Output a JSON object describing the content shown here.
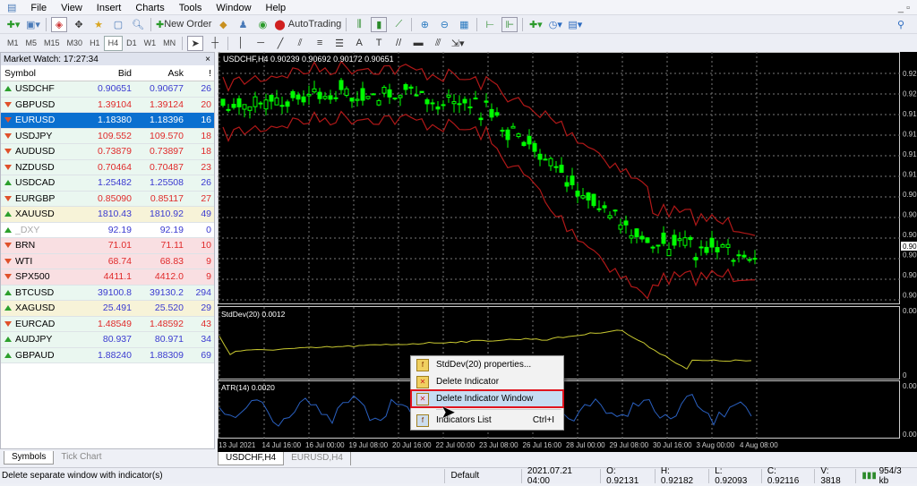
{
  "menu": {
    "items": [
      "File",
      "View",
      "Insert",
      "Charts",
      "Tools",
      "Window",
      "Help"
    ]
  },
  "toolbar": {
    "new_order": "New Order",
    "autotrading": "AutoTrading",
    "timeframes": [
      "M1",
      "M5",
      "M15",
      "M30",
      "H1",
      "H4",
      "D1",
      "W1",
      "MN"
    ],
    "active_timeframe": "H4"
  },
  "market_watch": {
    "title": "Market Watch: 17:27:34",
    "columns": [
      "Symbol",
      "Bid",
      "Ask",
      "!"
    ],
    "rows": [
      {
        "symbol": "USDCHF",
        "bid": "0.90651",
        "ask": "0.90677",
        "spread": "26",
        "dir": "up",
        "bg": "#eaf7f0",
        "color": "#3a3ad0"
      },
      {
        "symbol": "GBPUSD",
        "bid": "1.39104",
        "ask": "1.39124",
        "spread": "20",
        "dir": "down",
        "bg": "#eaf7f0",
        "color": "#e02a2a"
      },
      {
        "symbol": "EURUSD",
        "bid": "1.18380",
        "ask": "1.18396",
        "spread": "16",
        "dir": "down",
        "bg": "#0a6fd0",
        "color": "#ffffff",
        "selected": true
      },
      {
        "symbol": "USDJPY",
        "bid": "109.552",
        "ask": "109.570",
        "spread": "18",
        "dir": "down",
        "bg": "#eaf7f0",
        "color": "#e02a2a"
      },
      {
        "symbol": "AUDUSD",
        "bid": "0.73879",
        "ask": "0.73897",
        "spread": "18",
        "dir": "down",
        "bg": "#eaf7f0",
        "color": "#e02a2a"
      },
      {
        "symbol": "NZDUSD",
        "bid": "0.70464",
        "ask": "0.70487",
        "spread": "23",
        "dir": "down",
        "bg": "#eaf7f0",
        "color": "#e02a2a"
      },
      {
        "symbol": "USDCAD",
        "bid": "1.25482",
        "ask": "1.25508",
        "spread": "26",
        "dir": "up",
        "bg": "#eaf7f0",
        "color": "#3a3ad0"
      },
      {
        "symbol": "EURGBP",
        "bid": "0.85090",
        "ask": "0.85117",
        "spread": "27",
        "dir": "down",
        "bg": "#eaf7f0",
        "color": "#e02a2a"
      },
      {
        "symbol": "XAUUSD",
        "bid": "1810.43",
        "ask": "1810.92",
        "spread": "49",
        "dir": "up",
        "bg": "#f7f3d8",
        "color": "#3a3ad0"
      },
      {
        "symbol": "_DXY",
        "bid": "92.19",
        "ask": "92.19",
        "spread": "0",
        "dir": "up",
        "bg": "#ffffff",
        "color": "#3a3ad0",
        "muted": true
      },
      {
        "symbol": "BRN",
        "bid": "71.01",
        "ask": "71.11",
        "spread": "10",
        "dir": "down",
        "bg": "#f9dfe2",
        "color": "#e02a2a"
      },
      {
        "symbol": "WTI",
        "bid": "68.74",
        "ask": "68.83",
        "spread": "9",
        "dir": "down",
        "bg": "#f9dfe2",
        "color": "#e02a2a"
      },
      {
        "symbol": "SPX500",
        "bid": "4411.1",
        "ask": "4412.0",
        "spread": "9",
        "dir": "down",
        "bg": "#f9dfe2",
        "color": "#e02a2a"
      },
      {
        "symbol": "BTCUSD",
        "bid": "39100.8",
        "ask": "39130.2",
        "spread": "294",
        "dir": "up",
        "bg": "#eaf7f0",
        "color": "#3a3ad0"
      },
      {
        "symbol": "XAGUSD",
        "bid": "25.491",
        "ask": "25.520",
        "spread": "29",
        "dir": "up",
        "bg": "#f7f3d8",
        "color": "#3a3ad0"
      },
      {
        "symbol": "EURCAD",
        "bid": "1.48549",
        "ask": "1.48592",
        "spread": "43",
        "dir": "down",
        "bg": "#eaf7f0",
        "color": "#e02a2a"
      },
      {
        "symbol": "AUDJPY",
        "bid": "80.937",
        "ask": "80.971",
        "spread": "34",
        "dir": "up",
        "bg": "#eaf7f0",
        "color": "#3a3ad0"
      },
      {
        "symbol": "GBPAUD",
        "bid": "1.88240",
        "ask": "1.88309",
        "spread": "69",
        "dir": "up",
        "bg": "#eaf7f0",
        "color": "#3a3ad0"
      }
    ],
    "tabs": [
      "Symbols",
      "Tick Chart"
    ]
  },
  "chart": {
    "header": "USDCHF,H4  0.90239 0.90692 0.90172 0.90651",
    "stddev_label": "StdDev(20) 0.0012",
    "atr_label": "ATR(14) 0.0020",
    "price_labels": [
      "0.92",
      "0.92",
      "0.91",
      "0.91",
      "0.91",
      "0.91",
      "0.90",
      "0.90",
      "0.90",
      "0.90",
      "0.90",
      "0.90"
    ],
    "current_price_label": "0.90",
    "stddev_axis": [
      "0.004",
      "0"
    ],
    "atr_axis": [
      "0.00",
      "0.00"
    ],
    "time_labels": [
      "13 Jul 2021",
      "14 Jul 16:00",
      "16 Jul 00:00",
      "19 Jul 08:00",
      "20 Jul 16:00",
      "22 Jul 00:00",
      "23 Jul 08:00",
      "26 Jul 16:00",
      "28 Jul 00:00",
      "29 Jul 08:00",
      "30 Jul 16:00",
      "3 Aug 00:00",
      "4 Aug 08:00"
    ],
    "colors": {
      "bull": "#00ff00",
      "bands": "#b01818",
      "stddev": "#c8c830",
      "atr": "#2a60c0"
    },
    "tabs": [
      "USDCHF,H4",
      "EURUSD,H4"
    ]
  },
  "context_menu": {
    "items": [
      {
        "label": "StdDev(20) properties...",
        "shortcut": ""
      },
      {
        "label": "Delete Indicator",
        "shortcut": ""
      },
      {
        "label": "Delete Indicator Window",
        "shortcut": "",
        "highlighted": true
      },
      {
        "label": "Indicators List",
        "shortcut": "Ctrl+I"
      }
    ]
  },
  "status": {
    "message": "Delete separate window with indicator(s)",
    "profile": "Default",
    "datetime": "2021.07.21 04:00",
    "open": "O: 0.92131",
    "high": "H: 0.92182",
    "low": "L: 0.92093",
    "close": "C: 0.92116",
    "volume": "V: 3818",
    "traffic": "954/3 kb"
  }
}
